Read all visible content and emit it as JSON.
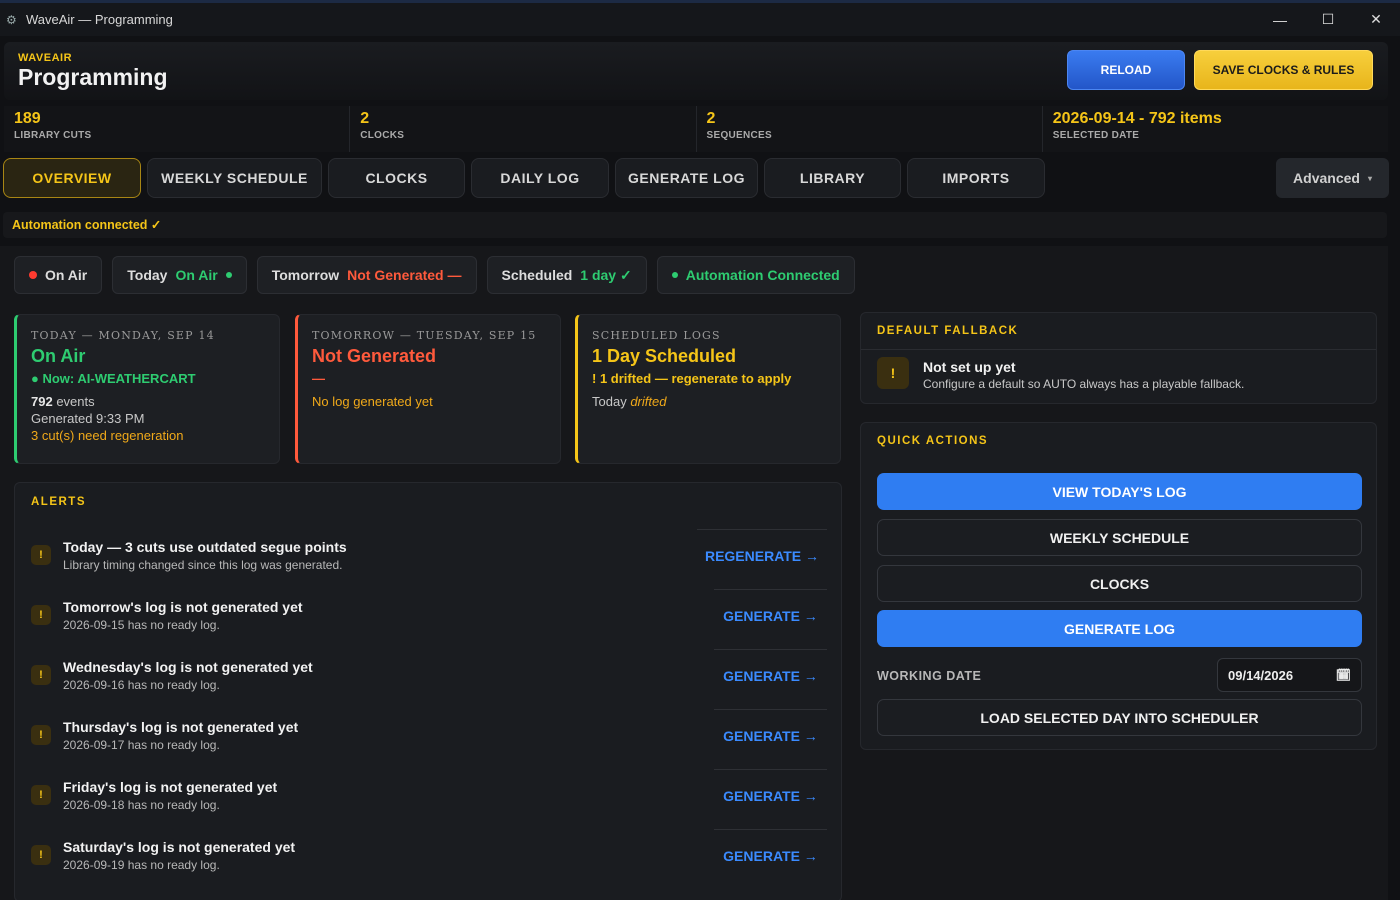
{
  "window": {
    "title": "WaveAir — Programming",
    "minimize": "—",
    "maximize": "☐",
    "close": "✕"
  },
  "header": {
    "brand": "WAVEAIR",
    "title": "Programming",
    "reload": "RELOAD",
    "save": "SAVE CLOCKS & RULES"
  },
  "stats": [
    {
      "value": "189",
      "label": "LIBRARY CUTS"
    },
    {
      "value": "2",
      "label": "CLOCKS"
    },
    {
      "value": "2",
      "label": "SEQUENCES"
    },
    {
      "value": "2026-09-14 - 792 items",
      "label": "SELECTED DATE"
    }
  ],
  "tabs": [
    "OVERVIEW",
    "WEEKLY SCHEDULE",
    "CLOCKS",
    "DAILY LOG",
    "GENERATE LOG",
    "LIBRARY",
    "IMPORTS"
  ],
  "advanced": {
    "label": "Advanced",
    "caret": "▾"
  },
  "automation_strip": "Automation connected ✓",
  "pills": {
    "onair": "On Air",
    "today_label": "Today",
    "today_value": "On Air",
    "tomorrow_label": "Tomorrow",
    "tomorrow_value": "Not Generated —",
    "scheduled_label": "Scheduled",
    "scheduled_value": "1 day ✓",
    "automation": "Automation Connected"
  },
  "cards": {
    "today": {
      "kicker": "TODAY — MONDAY, SEP 14",
      "status": "On Air",
      "now": "● Now: AI-WEATHERCART",
      "events_count": "792",
      "events_word": "events",
      "generated": "Generated 9:33 PM",
      "regen": "3 cut(s) need regeneration"
    },
    "tomorrow": {
      "kicker": "TOMORROW — TUESDAY, SEP 15",
      "status": "Not Generated",
      "dash": "—",
      "note": "No log generated yet"
    },
    "scheduled": {
      "kicker": "SCHEDULED LOGS",
      "status": "1 Day Scheduled",
      "drift": "! 1 drifted — regenerate to apply",
      "today_word": "Today",
      "drifted_word": "drifted"
    }
  },
  "fallback": {
    "title": "DEFAULT FALLBACK",
    "icon": "!",
    "heading": "Not set up yet",
    "sub": "Configure a default so AUTO always has a playable fallback."
  },
  "quick": {
    "title": "QUICK ACTIONS",
    "buttons": [
      "VIEW TODAY'S LOG",
      "WEEKLY SCHEDULE",
      "CLOCKS",
      "GENERATE LOG"
    ],
    "working_date_label": "WORKING DATE",
    "working_date": "09/14/2026",
    "load": "LOAD SELECTED DAY INTO SCHEDULER"
  },
  "alerts": {
    "title": "ALERTS",
    "items": [
      {
        "title": "Today — 3 cuts use outdated segue points",
        "sub": "Library timing changed since this log was generated.",
        "action": "REGENERATE →"
      },
      {
        "title": "Tomorrow's log is not generated yet",
        "sub": "2026-09-15 has no ready log.",
        "action": "GENERATE →"
      },
      {
        "title": "Wednesday's log is not generated yet",
        "sub": "2026-09-16 has no ready log.",
        "action": "GENERATE →"
      },
      {
        "title": "Thursday's log is not generated yet",
        "sub": "2026-09-17 has no ready log.",
        "action": "GENERATE →"
      },
      {
        "title": "Friday's log is not generated yet",
        "sub": "2026-09-18 has no ready log.",
        "action": "GENERATE →"
      },
      {
        "title": "Saturday's log is not generated yet",
        "sub": "2026-09-19 has no ready log.",
        "action": "GENERATE →"
      }
    ]
  },
  "colors": {
    "accent": "#f5c518",
    "primary": "#2f7df2",
    "ok": "#2ecc71",
    "danger": "#ff5a3c"
  },
  "icons": {
    "app": "gear-icon",
    "calendar": "calendar-icon",
    "warning": "warning-icon"
  }
}
